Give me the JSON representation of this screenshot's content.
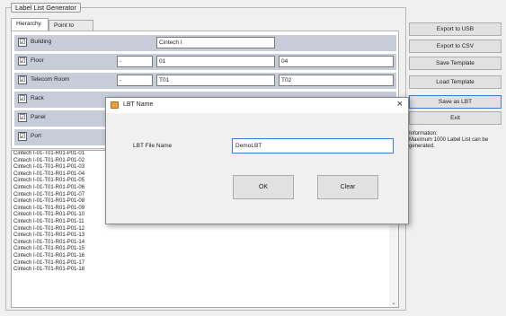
{
  "group_title": "Label List Generator",
  "tabs": [
    "Hierarchy",
    "Point to Point"
  ],
  "rows": [
    {
      "label": "Building",
      "checked": "☑",
      "prefix": "",
      "from": "Cintech I",
      "to": ""
    },
    {
      "label": "Floor",
      "checked": "☑",
      "prefix": "-",
      "from": "01",
      "to": "04"
    },
    {
      "label": "Telecom Room",
      "checked": "☑",
      "prefix": "-",
      "from": "T01",
      "to": "T02"
    },
    {
      "label": "Rack",
      "checked": "☑",
      "prefix": "",
      "from": "",
      "to": ""
    },
    {
      "label": "Panel",
      "checked": "☑",
      "prefix": "",
      "from": "",
      "to": ""
    },
    {
      "label": "Port",
      "checked": "☑",
      "prefix": "",
      "from": "",
      "to": ""
    }
  ],
  "list_items": [
    "Cintech I-01-T01-R01-P01-01",
    "Cintech I-01-T01-R01-P01-02",
    "Cintech I-01-T01-R01-P01-03",
    "Cintech I-01-T01-R01-P01-04",
    "Cintech I-01-T01-R01-P01-05",
    "Cintech I-01-T01-R01-P01-06",
    "Cintech I-01-T01-R01-P01-07",
    "Cintech I-01-T01-R01-P01-08",
    "Cintech I-01-T01-R01-P01-09",
    "Cintech I-01-T01-R01-P01-10",
    "Cintech I-01-T01-R01-P01-11",
    "Cintech I-01-T01-R01-P01-12",
    "Cintech I-01-T01-R01-P01-13",
    "Cintech I-01-T01-R01-P01-14",
    "Cintech I-01-T01-R01-P01-15",
    "Cintech I-01-T01-R01-P01-16",
    "Cintech I-01-T01-R01-P01-17",
    "Cintech I-01-T01-R01-P01-18"
  ],
  "buttons": {
    "export_usb": "Export to USB",
    "export_csv": "Export to CSV",
    "save_template": "Save Template",
    "load_template": "Load Template",
    "save_lbt": "Save as LBT",
    "exit": "Exit"
  },
  "info": {
    "heading": "Information:",
    "text": "Maximum 1000 Label List can be generated."
  },
  "dialog": {
    "title": "LBT Name",
    "close_glyph": "×",
    "field_label": "LBT File Name",
    "field_value": "DemoLBT",
    "ok": "OK",
    "clear": "Clear"
  },
  "icons": {
    "check": "check-icon",
    "close": "close-icon",
    "scroll_down": "chevron-down-icon",
    "app": "app-icon"
  },
  "scroll_arrow": "⌄",
  "colors": {
    "row_bg": "#c7cdd8",
    "focus_border": "#3d7bd4"
  }
}
